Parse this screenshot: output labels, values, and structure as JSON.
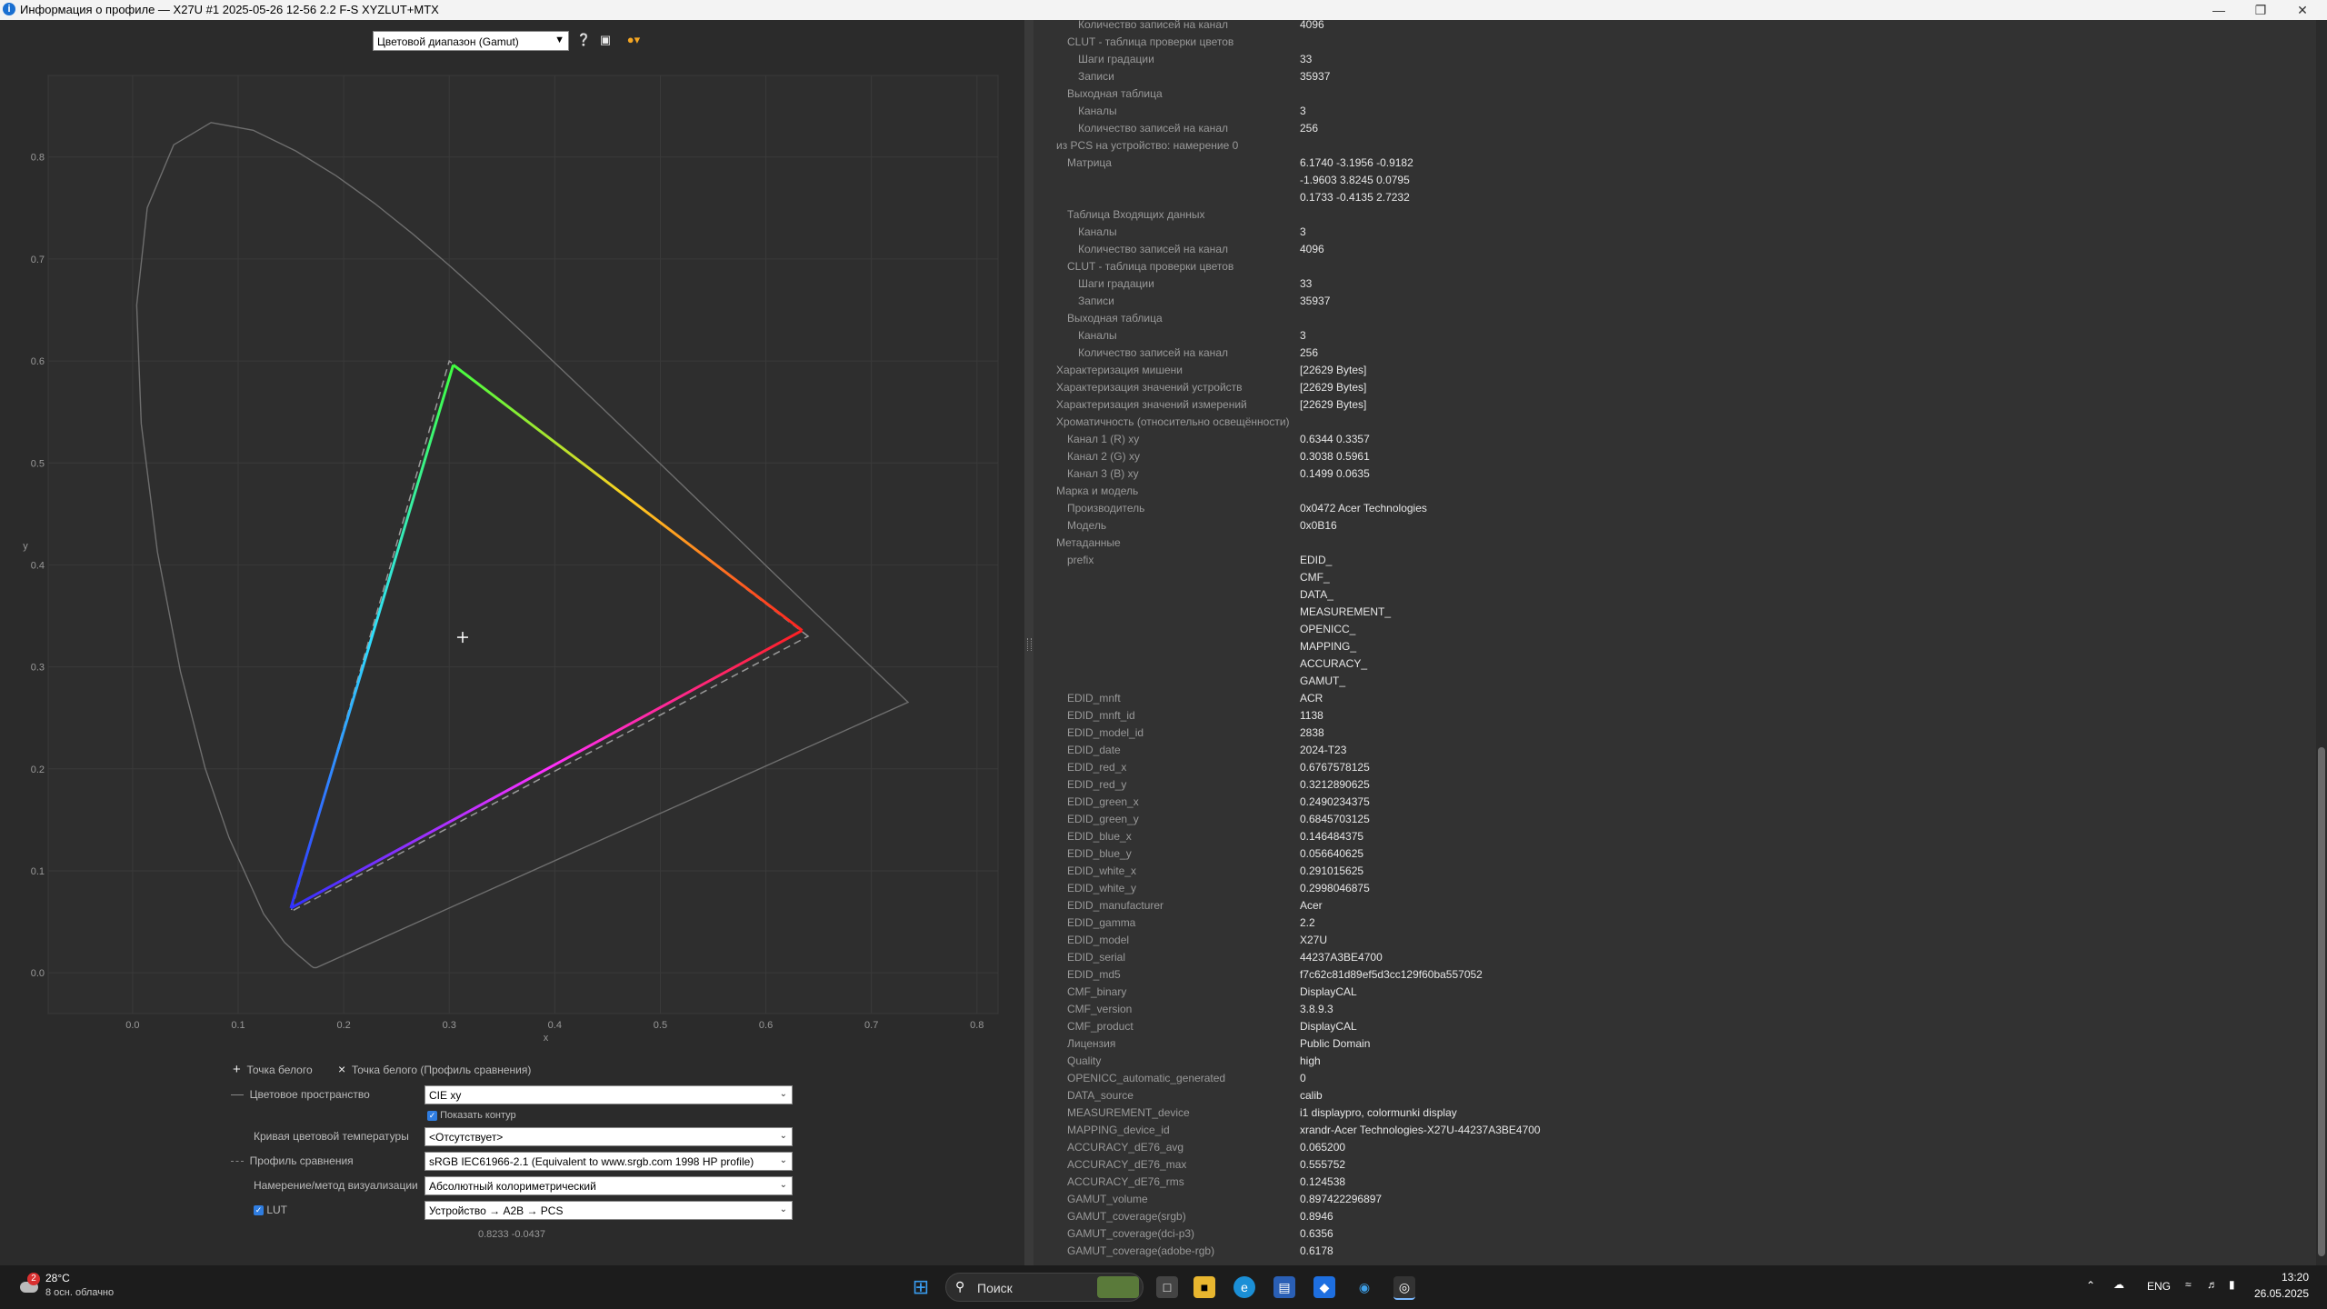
{
  "window": {
    "title": "Информация о профиле — X27U #1 2025-05-26 12-56 2.2 F-S XYZLUT+MTX",
    "icon": "info-icon"
  },
  "view_select": {
    "value": "Цветовой диапазон (Gamut)"
  },
  "chart_data": {
    "type": "scatter",
    "xlabel": "x",
    "ylabel": "y",
    "xlim": [
      -0.08,
      0.82
    ],
    "ylim": [
      -0.04,
      0.88
    ],
    "x_ticks": [
      "0.0",
      "0.1",
      "0.2",
      "0.3",
      "0.4",
      "0.5",
      "0.6",
      "0.7",
      "0.8"
    ],
    "y_ticks": [
      "0.0",
      "0.1",
      "0.2",
      "0.3",
      "0.4",
      "0.5",
      "0.6",
      "0.7",
      "0.8"
    ],
    "grid": true,
    "spectral_locus": [
      [
        0.1741,
        0.005
      ],
      [
        0.1714,
        0.0051
      ],
      [
        0.1689,
        0.0069
      ],
      [
        0.1644,
        0.0109
      ],
      [
        0.1566,
        0.0177
      ],
      [
        0.144,
        0.0297
      ],
      [
        0.1241,
        0.0578
      ],
      [
        0.0913,
        0.1327
      ],
      [
        0.0687,
        0.2007
      ],
      [
        0.0454,
        0.295
      ],
      [
        0.0235,
        0.4127
      ],
      [
        0.0082,
        0.5384
      ],
      [
        0.0039,
        0.6548
      ],
      [
        0.0139,
        0.7502
      ],
      [
        0.0389,
        0.812
      ],
      [
        0.0743,
        0.8338
      ],
      [
        0.1142,
        0.8262
      ],
      [
        0.1547,
        0.8059
      ],
      [
        0.1929,
        0.7816
      ],
      [
        0.2296,
        0.7543
      ],
      [
        0.2658,
        0.7243
      ],
      [
        0.3016,
        0.6923
      ],
      [
        0.3373,
        0.6589
      ],
      [
        0.3731,
        0.6245
      ],
      [
        0.4087,
        0.5896
      ],
      [
        0.4441,
        0.5547
      ],
      [
        0.4788,
        0.5202
      ],
      [
        0.5125,
        0.4866
      ],
      [
        0.5448,
        0.4544
      ],
      [
        0.5752,
        0.4242
      ],
      [
        0.6029,
        0.3965
      ],
      [
        0.627,
        0.3725
      ],
      [
        0.6482,
        0.3514
      ],
      [
        0.6658,
        0.334
      ],
      [
        0.6801,
        0.3197
      ],
      [
        0.6915,
        0.3083
      ],
      [
        0.7006,
        0.2993
      ],
      [
        0.7079,
        0.292
      ],
      [
        0.714,
        0.2859
      ],
      [
        0.719,
        0.2809
      ],
      [
        0.723,
        0.277
      ],
      [
        0.726,
        0.274
      ],
      [
        0.7283,
        0.2717
      ],
      [
        0.73,
        0.27
      ],
      [
        0.7347,
        0.2653
      ]
    ],
    "profile_gamut": {
      "red": [
        0.6344,
        0.3357
      ],
      "green": [
        0.3038,
        0.5961
      ],
      "blue": [
        0.1499,
        0.0635
      ]
    },
    "reference_gamut": {
      "red": [
        0.64,
        0.33
      ],
      "green": [
        0.3,
        0.6
      ],
      "blue": [
        0.15,
        0.06
      ]
    },
    "whitepoint": [
      0.3127,
      0.329
    ],
    "colors": {
      "locus": "#6e6e6e",
      "grid": "#3a3a3a",
      "reference": "#9a9a9a",
      "red": "#ff2a2a",
      "green": "#3cff3c",
      "blue": "#3a3aff"
    }
  },
  "form": {
    "legend_wp": "Точка белого",
    "legend_wp_ref": "Точка белого (Профиль сравнения)",
    "colorspace_label": "Цветовое пространство",
    "colorspace_value": "CIE xy",
    "show_outline_label": "Показать контур",
    "cct_label": "Кривая цветовой температуры",
    "cct_value": "<Отсутствует>",
    "compare_label": "Профиль сравнения",
    "compare_value": "sRGB IEC61966-2.1 (Equivalent to www.srgb.com 1998 HP profile)",
    "intent_label": "Намерение/метод визуализации",
    "intent_value": "Абсолютный колориметрический",
    "lut_label": "LUT",
    "lut_value": "Устройство → A2B → PCS",
    "coords": "0.8233 -0.0437"
  },
  "details": [
    {
      "k": "Количество записей на канал",
      "v": "4096",
      "i": 2
    },
    {
      "k": "CLUT - таблица проверки цветов",
      "v": "",
      "i": 1
    },
    {
      "k": "Шаги градации",
      "v": "33",
      "i": 2
    },
    {
      "k": "Записи",
      "v": "35937",
      "i": 2
    },
    {
      "k": "Выходная таблица",
      "v": "",
      "i": 1
    },
    {
      "k": "Каналы",
      "v": "3",
      "i": 2
    },
    {
      "k": "Количество записей на канал",
      "v": "256",
      "i": 2
    },
    {
      "k": "из PCS на устройство: намерение 0",
      "v": "",
      "i": 0
    },
    {
      "k": "Матрица",
      "v": "6.1740 -3.1956 -0.9182",
      "i": 1
    },
    {
      "k": "",
      "v": "-1.9603 3.8245 0.0795",
      "i": 1
    },
    {
      "k": "",
      "v": "0.1733 -0.4135 2.7232",
      "i": 1
    },
    {
      "k": "Таблица Входящих данных",
      "v": "",
      "i": 1
    },
    {
      "k": "Каналы",
      "v": "3",
      "i": 2
    },
    {
      "k": "Количество записей на канал",
      "v": "4096",
      "i": 2
    },
    {
      "k": "CLUT - таблица проверки цветов",
      "v": "",
      "i": 1
    },
    {
      "k": "Шаги градации",
      "v": "33",
      "i": 2
    },
    {
      "k": "Записи",
      "v": "35937",
      "i": 2
    },
    {
      "k": "Выходная таблица",
      "v": "",
      "i": 1
    },
    {
      "k": "Каналы",
      "v": "3",
      "i": 2
    },
    {
      "k": "Количество записей на канал",
      "v": "256",
      "i": 2
    },
    {
      "k": "Характеризация мишени",
      "v": "[22629 Bytes]",
      "i": 0
    },
    {
      "k": "Характеризация значений устройств",
      "v": "[22629 Bytes]",
      "i": 0
    },
    {
      "k": "Характеризация значений измерений",
      "v": "[22629 Bytes]",
      "i": 0
    },
    {
      "k": "Хроматичность (относительно освещённости)",
      "v": "",
      "i": 0
    },
    {
      "k": "Канал 1 (R) xy",
      "v": "0.6344 0.3357",
      "i": 1
    },
    {
      "k": "Канал 2 (G) xy",
      "v": "0.3038 0.5961",
      "i": 1
    },
    {
      "k": "Канал 3 (B) xy",
      "v": "0.1499 0.0635",
      "i": 1
    },
    {
      "k": "Марка и модель",
      "v": "",
      "i": 0
    },
    {
      "k": "Производитель",
      "v": "0x0472 Acer Technologies",
      "i": 1
    },
    {
      "k": "Модель",
      "v": "0x0B16",
      "i": 1
    },
    {
      "k": "Метаданные",
      "v": "",
      "i": 0
    },
    {
      "k": "prefix",
      "v": "EDID_",
      "i": 1
    },
    {
      "k": "",
      "v": "CMF_",
      "i": 1
    },
    {
      "k": "",
      "v": "DATA_",
      "i": 1
    },
    {
      "k": "",
      "v": "MEASUREMENT_",
      "i": 1
    },
    {
      "k": "",
      "v": "OPENICC_",
      "i": 1
    },
    {
      "k": "",
      "v": "MAPPING_",
      "i": 1
    },
    {
      "k": "",
      "v": "ACCURACY_",
      "i": 1
    },
    {
      "k": "",
      "v": "GAMUT_",
      "i": 1
    },
    {
      "k": "EDID_mnft",
      "v": "ACR",
      "i": 1
    },
    {
      "k": "EDID_mnft_id",
      "v": "1138",
      "i": 1
    },
    {
      "k": "EDID_model_id",
      "v": "2838",
      "i": 1
    },
    {
      "k": "EDID_date",
      "v": "2024-T23",
      "i": 1
    },
    {
      "k": "EDID_red_x",
      "v": "0.6767578125",
      "i": 1
    },
    {
      "k": "EDID_red_y",
      "v": "0.3212890625",
      "i": 1
    },
    {
      "k": "EDID_green_x",
      "v": "0.2490234375",
      "i": 1
    },
    {
      "k": "EDID_green_y",
      "v": "0.6845703125",
      "i": 1
    },
    {
      "k": "EDID_blue_x",
      "v": "0.146484375",
      "i": 1
    },
    {
      "k": "EDID_blue_y",
      "v": "0.056640625",
      "i": 1
    },
    {
      "k": "EDID_white_x",
      "v": "0.291015625",
      "i": 1
    },
    {
      "k": "EDID_white_y",
      "v": "0.2998046875",
      "i": 1
    },
    {
      "k": "EDID_manufacturer",
      "v": "Acer",
      "i": 1
    },
    {
      "k": "EDID_gamma",
      "v": "2.2",
      "i": 1
    },
    {
      "k": "EDID_model",
      "v": "X27U",
      "i": 1
    },
    {
      "k": "EDID_serial",
      "v": "44237A3BE4700",
      "i": 1
    },
    {
      "k": "EDID_md5",
      "v": "f7c62c81d89ef5d3cc129f60ba557052",
      "i": 1
    },
    {
      "k": "CMF_binary",
      "v": "DisplayCAL",
      "i": 1
    },
    {
      "k": "CMF_version",
      "v": "3.8.9.3",
      "i": 1
    },
    {
      "k": "CMF_product",
      "v": "DisplayCAL",
      "i": 1
    },
    {
      "k": "Лицензия",
      "v": "Public Domain",
      "i": 1
    },
    {
      "k": "Quality",
      "v": "high",
      "i": 1
    },
    {
      "k": "OPENICC_automatic_generated",
      "v": "0",
      "i": 1
    },
    {
      "k": "DATA_source",
      "v": "calib",
      "i": 1
    },
    {
      "k": "MEASUREMENT_device",
      "v": "i1 displaypro, colormunki display",
      "i": 1
    },
    {
      "k": "MAPPING_device_id",
      "v": "xrandr-Acer Technologies-X27U-44237A3BE4700",
      "i": 1
    },
    {
      "k": "ACCURACY_dE76_avg",
      "v": "0.065200",
      "i": 1
    },
    {
      "k": "ACCURACY_dE76_max",
      "v": "0.555752",
      "i": 1
    },
    {
      "k": "ACCURACY_dE76_rms",
      "v": "0.124538",
      "i": 1
    },
    {
      "k": "GAMUT_volume",
      "v": "0.897422296897",
      "i": 1
    },
    {
      "k": "GAMUT_coverage(srgb)",
      "v": "0.8946",
      "i": 1
    },
    {
      "k": "GAMUT_coverage(dci-p3)",
      "v": "0.6356",
      "i": 1
    },
    {
      "k": "GAMUT_coverage(adobe-rgb)",
      "v": "0.6178",
      "i": 1
    }
  ],
  "taskbar": {
    "weather_temp": "28°C",
    "weather_desc": "8 осн. облачно",
    "weather_badge": "2",
    "search_placeholder": "Поиск",
    "lang": "ENG",
    "time": "13:20",
    "date": "26.05.2025"
  }
}
